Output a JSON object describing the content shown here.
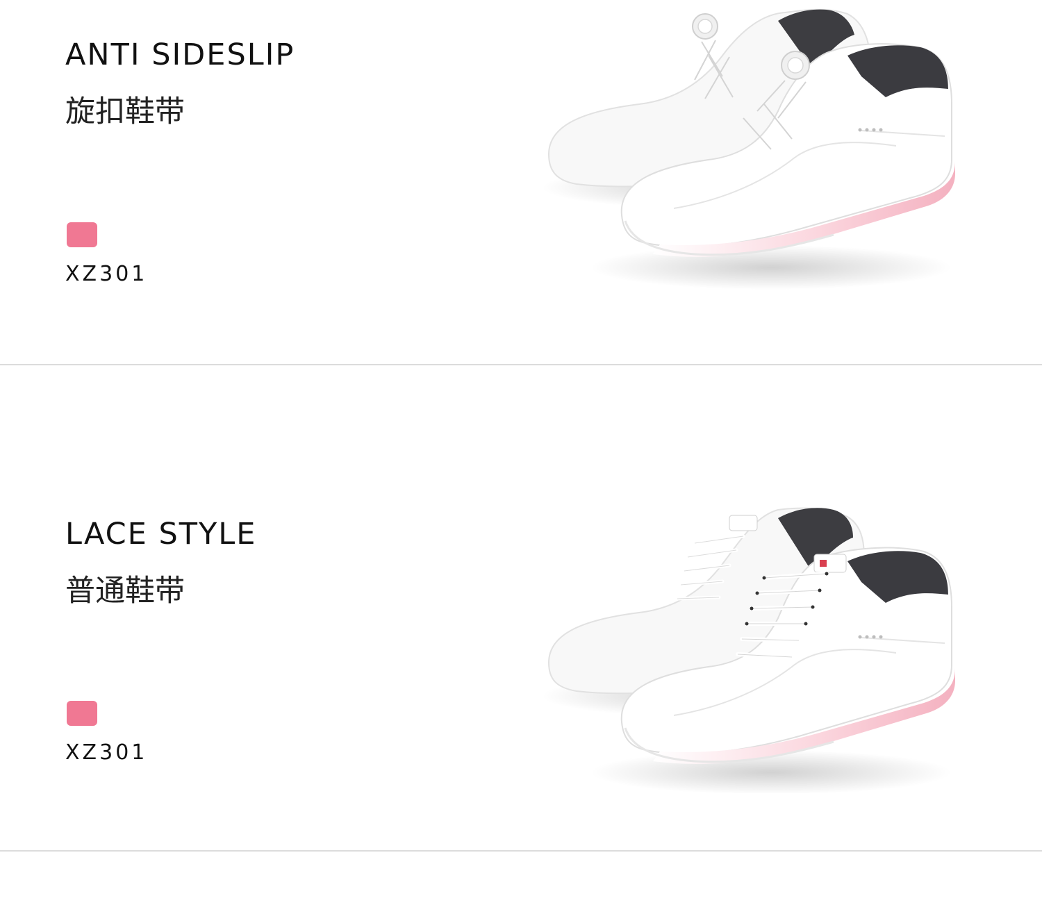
{
  "colors": {
    "swatch": "#f07893",
    "shoe_upper": "#ffffff",
    "sole_accent": "#f6b9c6",
    "divider": "#dcdcdc",
    "text": "#111111"
  },
  "sections": [
    {
      "title_en": "ANTI SIDESLIP",
      "title_cn": "旋扣鞋带",
      "model": "XZ301",
      "image_icon": "boa-dial-golf-shoes-image"
    },
    {
      "title_en": "LACE STYLE",
      "title_cn": "普通鞋带",
      "model": "XZ301",
      "image_icon": "lace-up-golf-shoes-image"
    }
  ]
}
